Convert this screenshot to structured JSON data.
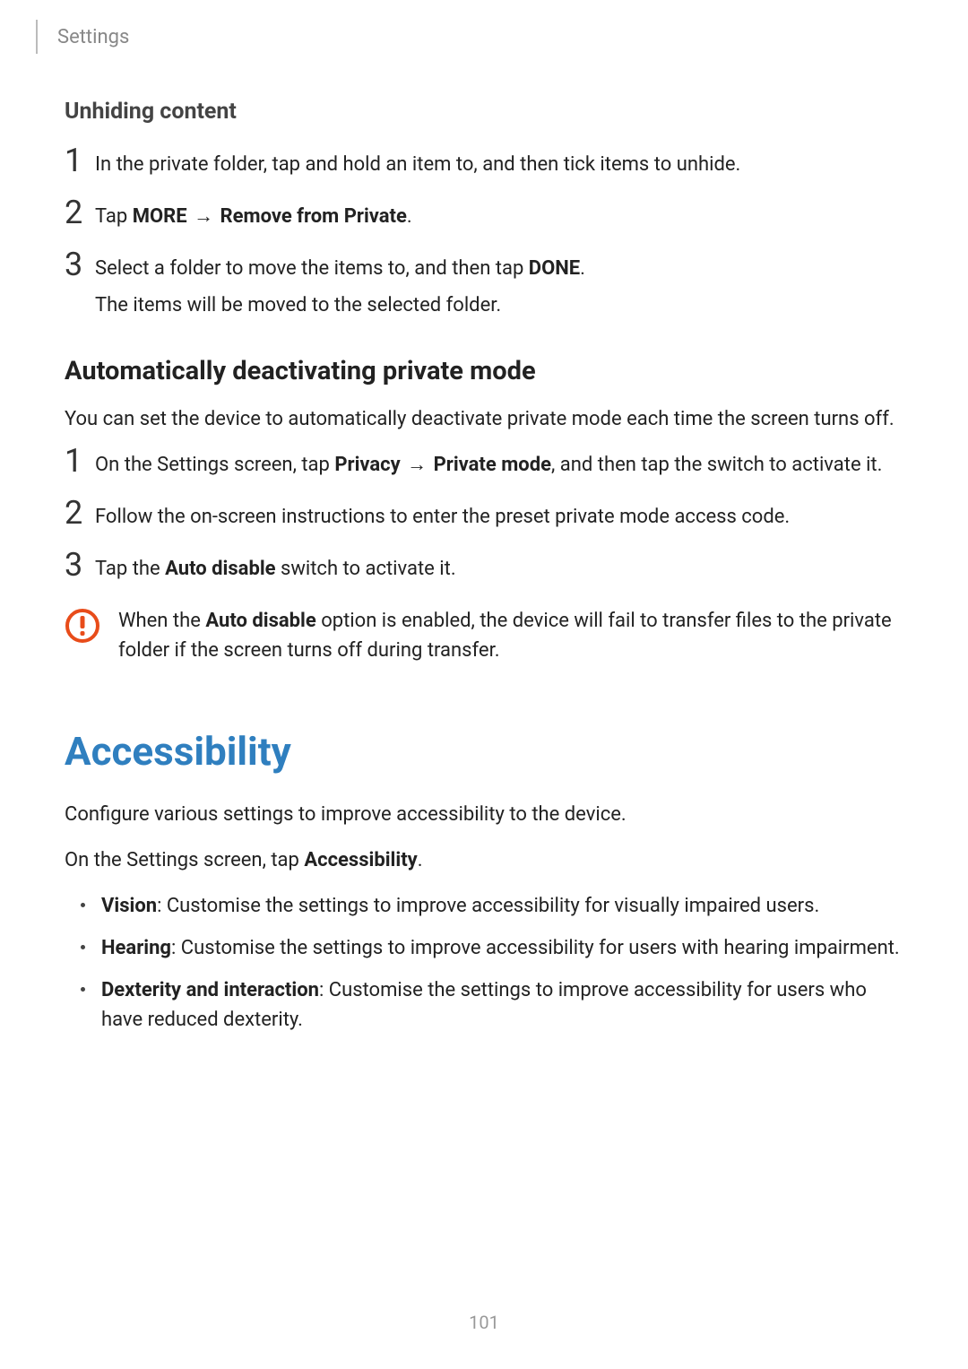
{
  "header": {
    "breadcrumb": "Settings"
  },
  "section1": {
    "title": "Unhiding content",
    "steps": [
      {
        "num": "1",
        "text": "In the private folder, tap and hold an item to, and then tick items to unhide."
      },
      {
        "num": "2",
        "prefix": "Tap ",
        "bold1": "MORE",
        "arrow": " → ",
        "bold2": "Remove from Private",
        "suffix": "."
      },
      {
        "num": "3",
        "prefix": "Select a folder to move the items to, and then tap ",
        "bold1": "DONE",
        "suffix": ".",
        "sub": "The items will be moved to the selected folder."
      }
    ]
  },
  "section2": {
    "title": "Automatically deactivating private mode",
    "intro": "You can set the device to automatically deactivate private mode each time the screen turns off.",
    "steps": [
      {
        "num": "1",
        "prefix": "On the Settings screen, tap ",
        "bold1": "Privacy",
        "arrow": " → ",
        "bold2": "Private mode",
        "suffix": ", and then tap the switch to activate it."
      },
      {
        "num": "2",
        "text": "Follow the on-screen instructions to enter the preset private mode access code."
      },
      {
        "num": "3",
        "prefix": "Tap the ",
        "bold1": "Auto disable",
        "suffix": " switch to activate it."
      }
    ],
    "note": {
      "prefix": "When the ",
      "bold": "Auto disable",
      "suffix": " option is enabled, the device will fail to transfer files to the private folder if the screen turns off during transfer."
    }
  },
  "section3": {
    "title": "Accessibility",
    "intro1": "Configure various settings to improve accessibility to the device.",
    "intro2_prefix": "On the Settings screen, tap ",
    "intro2_bold": "Accessibility",
    "intro2_suffix": ".",
    "bullets": [
      {
        "bold": "Vision",
        "text": ": Customise the settings to improve accessibility for visually impaired users."
      },
      {
        "bold": "Hearing",
        "text": ": Customise the settings to improve accessibility for users with hearing impairment."
      },
      {
        "bold": "Dexterity and interaction",
        "text": ": Customise the settings to improve accessibility for users who have reduced dexterity."
      }
    ]
  },
  "pageNumber": "101"
}
